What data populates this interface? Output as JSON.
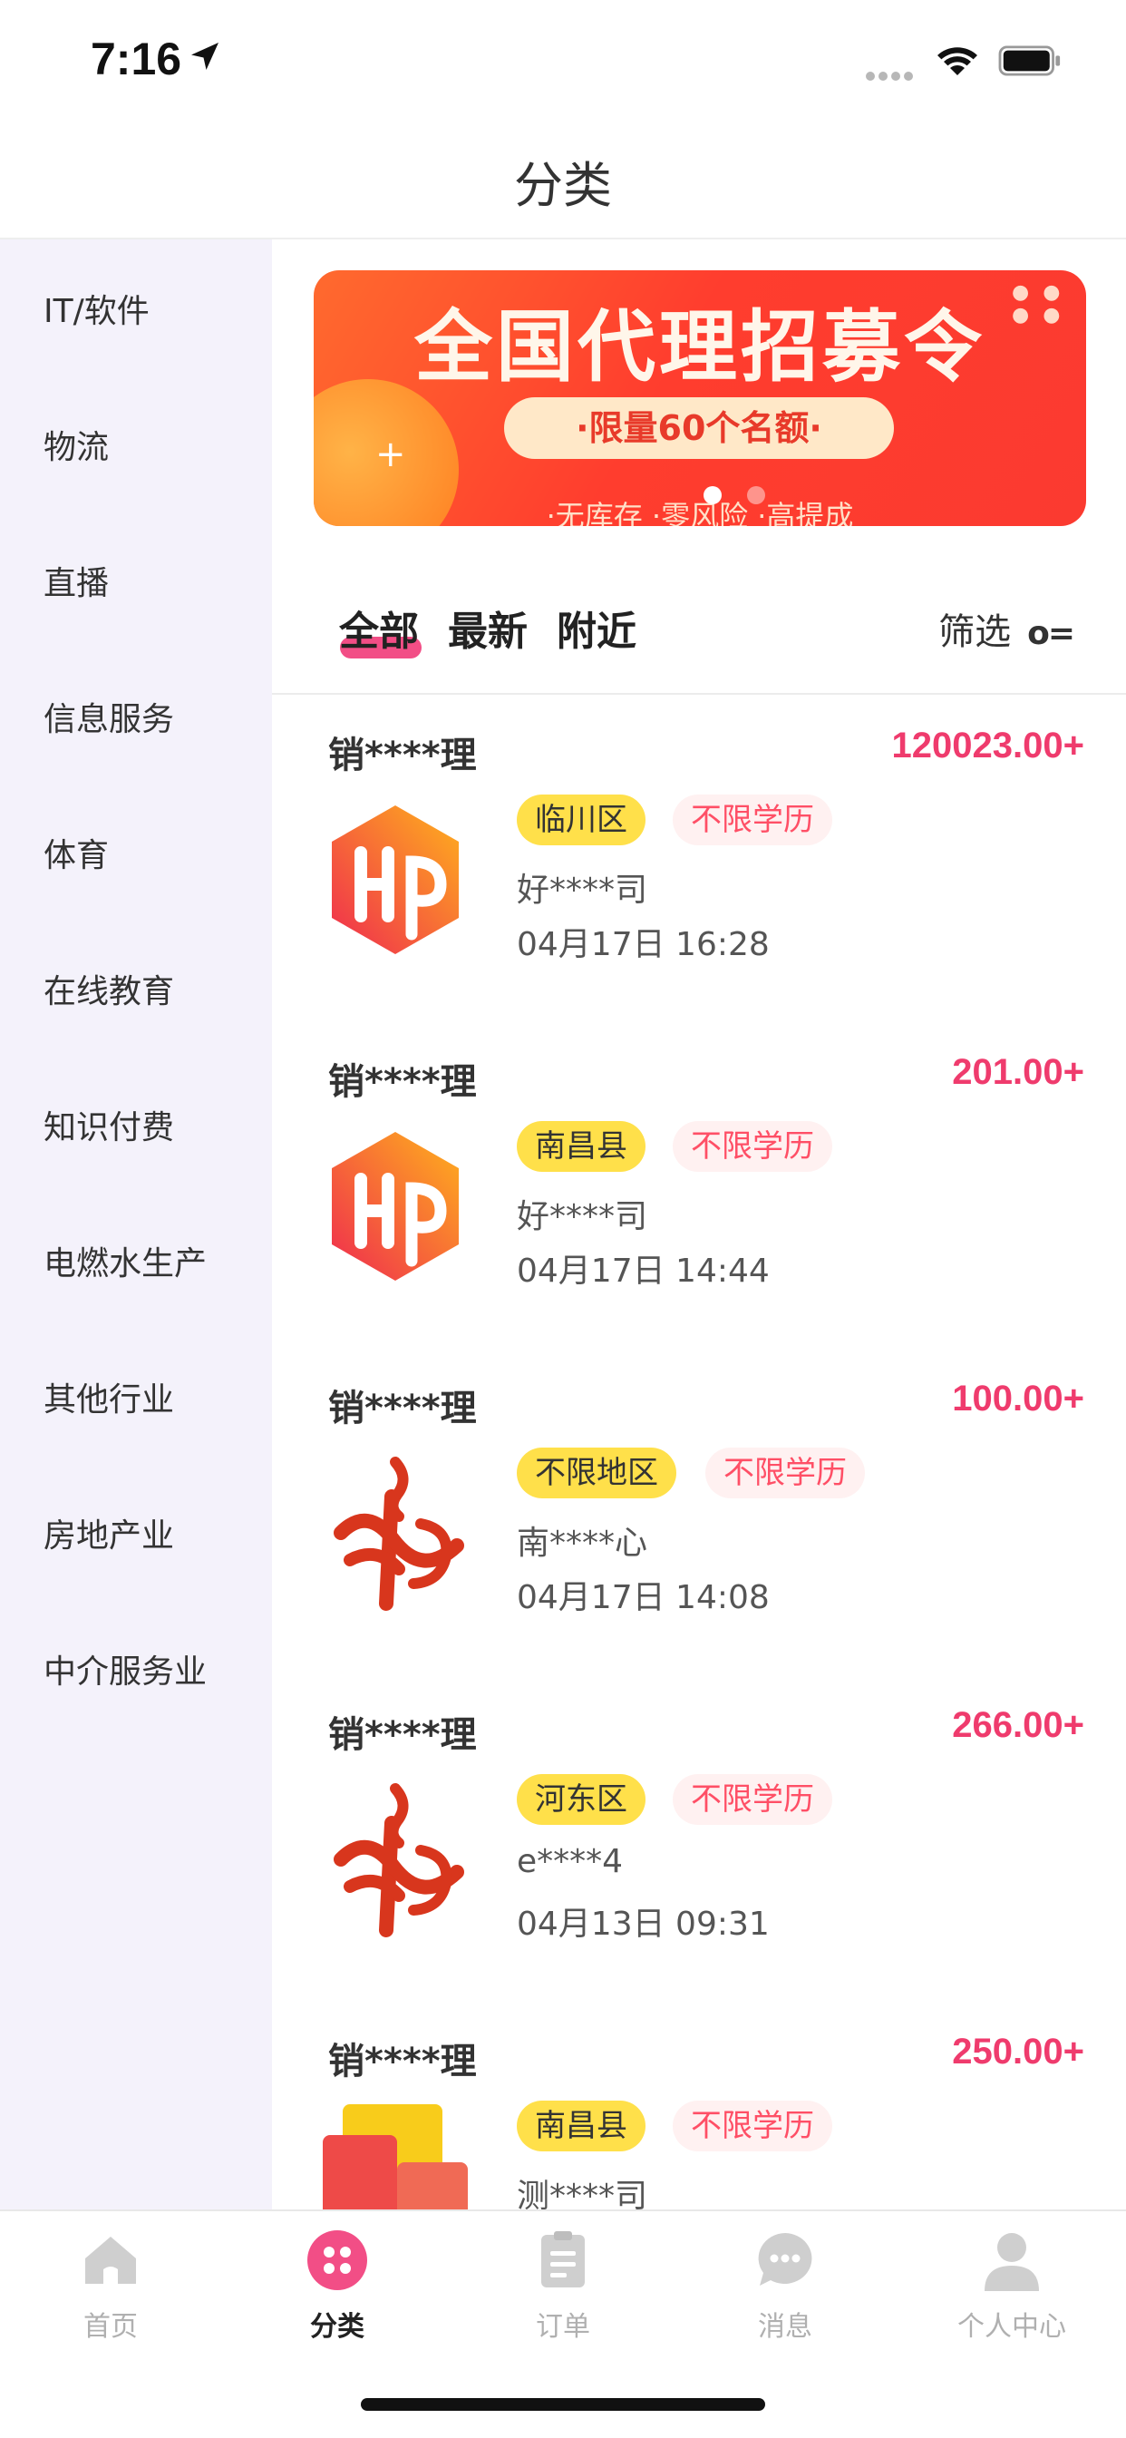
{
  "status_bar": {
    "time": "7:16"
  },
  "nav": {
    "title": "分类"
  },
  "sidebar": {
    "items": [
      {
        "label": "IT/软件"
      },
      {
        "label": "物流"
      },
      {
        "label": "直播"
      },
      {
        "label": "信息服务"
      },
      {
        "label": "体育"
      },
      {
        "label": "在线教育"
      },
      {
        "label": "知识付费"
      },
      {
        "label": "电燃水生产"
      },
      {
        "label": "其他行业"
      },
      {
        "label": "房地产业"
      },
      {
        "label": "中介服务业"
      }
    ]
  },
  "banner": {
    "title": "全国代理招募令",
    "pill": "·限量60个名额·",
    "footer": "·无库存 ·零风险 ·高提成"
  },
  "tabs": {
    "items": [
      {
        "label": "全部"
      },
      {
        "label": "最新"
      },
      {
        "label": "附近"
      }
    ],
    "active": "全部",
    "filter_label": "筛选"
  },
  "jobs": [
    {
      "title": "销****理",
      "salary": "120023.00+",
      "area": "临川区",
      "education": "不限学历",
      "company": "好****司",
      "time": "04月17日 16:28",
      "logo": "hp-logo"
    },
    {
      "title": "销****理",
      "salary": "201.00+",
      "area": "南昌县",
      "education": "不限学历",
      "company": "好****司",
      "time": "04月17日 14:44",
      "logo": "hp-logo"
    },
    {
      "title": "销****理",
      "salary": "100.00+",
      "area": "不限地区",
      "education": "不限学历",
      "company": "南****心",
      "time": "04月17日 14:08",
      "logo": "red-swirl-logo"
    },
    {
      "title": "销****理",
      "salary": "266.00+",
      "area": "河东区",
      "education": "不限学历",
      "company": "e****4",
      "time": "04月13日 09:31",
      "logo": "red-swirl-logo"
    },
    {
      "title": "销****理",
      "salary": "250.00+",
      "area": "南昌县",
      "education": "不限学历",
      "company": "测****司",
      "time": "",
      "logo": "block-logo"
    }
  ],
  "tabbar": {
    "items": [
      {
        "label": "首页",
        "icon": "home-icon",
        "active": false
      },
      {
        "label": "分类",
        "icon": "category-icon",
        "active": true
      },
      {
        "label": "订单",
        "icon": "order-icon",
        "active": false
      },
      {
        "label": "消息",
        "icon": "message-icon",
        "active": false
      },
      {
        "label": "个人中心",
        "icon": "profile-icon",
        "active": false
      }
    ]
  },
  "colors": {
    "accent": "#ef3b6d",
    "tab_underline": "#f24e86",
    "area_tag": "#ffe04a",
    "edu_tag_bg": "#fff1f1",
    "edu_tag_text": "#ff4f66",
    "sidebar_bg": "#f4f2fb",
    "banner_red": "#fb3a30"
  }
}
